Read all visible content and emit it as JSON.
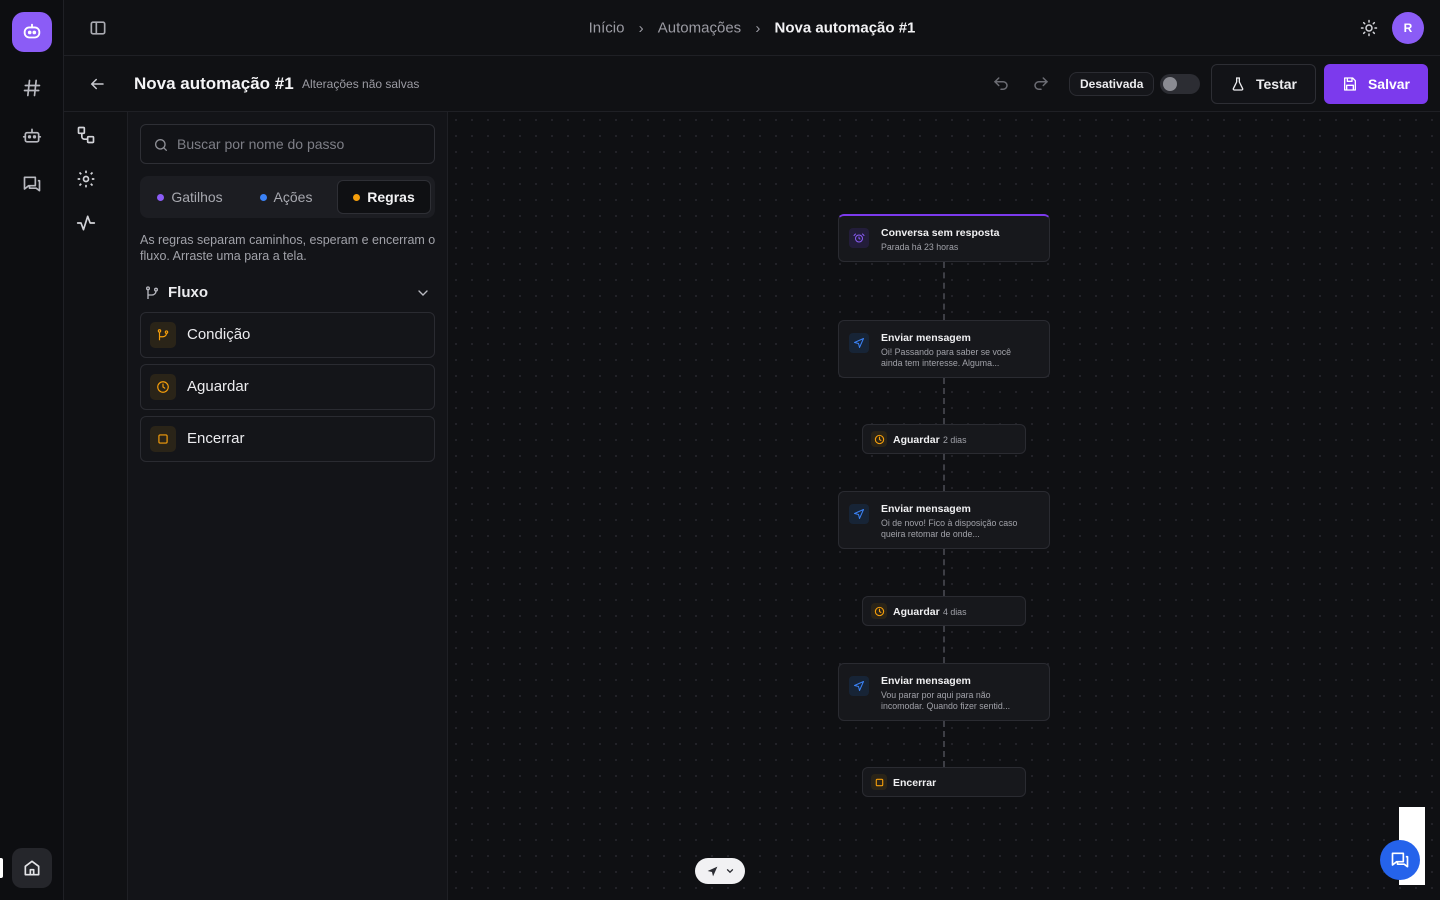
{
  "rail": {
    "items": [
      {
        "name": "hash-icon"
      },
      {
        "name": "bot-icon"
      },
      {
        "name": "chats-icon"
      }
    ]
  },
  "topbar": {
    "breadcrumbs": [
      "Início",
      "Automações",
      "Nova automação #1"
    ],
    "separator": ">",
    "avatar_initial": "R"
  },
  "header": {
    "title": "Nova automação #1",
    "unsaved": "Alterações não salvas",
    "status_label": "Desativada",
    "active": false,
    "test_label": "Testar",
    "save_label": "Salvar"
  },
  "panel": {
    "search_placeholder": "Buscar por nome do passo",
    "tabs": [
      {
        "label": "Gatilhos",
        "color": "#8b5cf6",
        "active": false
      },
      {
        "label": "Ações",
        "color": "#3b82f6",
        "active": false
      },
      {
        "label": "Regras",
        "color": "#f59e0b",
        "active": true
      }
    ],
    "help": "As regras separam caminhos, esperam e encerram o fluxo. Arraste uma para a tela.",
    "section_title": "Fluxo",
    "rules": [
      {
        "label": "Condição",
        "icon": "branch-icon"
      },
      {
        "label": "Aguardar",
        "icon": "clock-icon"
      },
      {
        "label": "Encerrar",
        "icon": "stop-icon"
      }
    ]
  },
  "canvas": {
    "nodes": [
      {
        "type": "trigger",
        "title": "Conversa sem resposta",
        "subtitle": "Parada há 23 horas",
        "icon": "alarm-icon"
      },
      {
        "type": "action",
        "title": "Enviar mensagem",
        "subtitle": "Oi! Passando para saber se você ainda tem interesse. Alguma...",
        "icon": "send-icon"
      },
      {
        "type": "wait",
        "title": "Aguardar",
        "value": "2 dias",
        "icon": "clock-icon"
      },
      {
        "type": "action",
        "title": "Enviar mensagem",
        "subtitle": "Oi de novo! Fico à disposição caso queira retomar de onde...",
        "icon": "send-icon"
      },
      {
        "type": "wait",
        "title": "Aguardar",
        "value": "4 dias",
        "icon": "clock-icon"
      },
      {
        "type": "action",
        "title": "Enviar mensagem",
        "subtitle": "Vou parar por aqui para não incomodar. Quando fizer sentid...",
        "icon": "send-icon"
      },
      {
        "type": "end",
        "title": "Encerrar",
        "icon": "stop-icon"
      }
    ]
  },
  "colors": {
    "accent": "#7c3aed",
    "rule": "#f59e0b",
    "action": "#3b82f6"
  }
}
